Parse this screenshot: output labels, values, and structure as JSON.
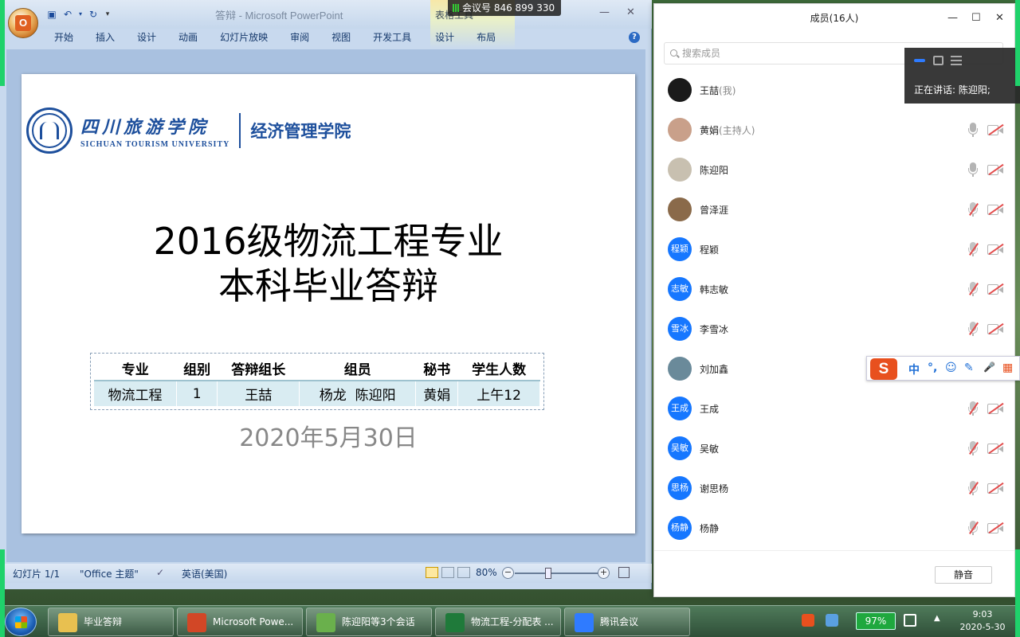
{
  "powerpoint": {
    "title": "答辩 - Microsoft PowerPoint",
    "office_button": "O",
    "table_tools_label": "表格工具",
    "tabs": [
      "开始",
      "插入",
      "设计",
      "动画",
      "幻灯片放映",
      "审阅",
      "视图",
      "开发工具",
      "设计",
      "布局"
    ],
    "help": "?",
    "slide": {
      "university_cn": "四川旅游学院",
      "university_en": "SICHUAN TOURISM UNIVERSITY",
      "college": "经济管理学院",
      "title_line1": "2016级物流工程专业",
      "title_line2": "本科毕业答辩",
      "table": {
        "headers": [
          "专业",
          "组别",
          "答辩组长",
          "组员",
          "秘书",
          "学生人数"
        ],
        "row": [
          "物流工程",
          "1",
          "王喆",
          "杨龙  陈迎阳",
          "黄娟",
          "上午12"
        ]
      },
      "date": "2020年5月30日"
    },
    "status": {
      "slide_count": "幻灯片 1/1",
      "theme": "\"Office 主题\"",
      "language": "英语(美国)",
      "zoom": "80%",
      "zoom_level": 0.8
    }
  },
  "meeting_bar": {
    "meeting_number": "会议号 846 899 330"
  },
  "members_panel": {
    "title": "成员(16人)",
    "search_placeholder": "搜索成员",
    "speaking": "正在讲话: 陈迎阳;",
    "mute_all": "静音",
    "members": [
      {
        "name": "王喆",
        "tag": "(我)",
        "avatar": "",
        "avatar_color": "#1a1a1a",
        "mic": "none",
        "cam": "none"
      },
      {
        "name": "黄娟",
        "tag": "(主持人)",
        "avatar": "",
        "avatar_color": "#c9a08a",
        "mic": "on",
        "cam": "off"
      },
      {
        "name": "陈迎阳",
        "tag": "",
        "avatar": "",
        "avatar_color": "#c8c0b0",
        "mic": "on",
        "cam": "off"
      },
      {
        "name": "曾泽涯",
        "tag": "",
        "avatar": "",
        "avatar_color": "#8a6a4a",
        "mic": "muted",
        "cam": "off"
      },
      {
        "name": "程颖",
        "tag": "",
        "avatar": "程颖",
        "avatar_color": "#1677ff",
        "mic": "muted",
        "cam": "off"
      },
      {
        "name": "韩志敏",
        "tag": "",
        "avatar": "志敏",
        "avatar_color": "#1677ff",
        "mic": "muted",
        "cam": "off"
      },
      {
        "name": "李雪冰",
        "tag": "",
        "avatar": "雪冰",
        "avatar_color": "#1677ff",
        "mic": "muted",
        "cam": "off"
      },
      {
        "name": "刘加鑫",
        "tag": "",
        "avatar": "",
        "avatar_color": "#6a8a9a",
        "mic": "none",
        "cam": "none"
      },
      {
        "name": "王成",
        "tag": "",
        "avatar": "王成",
        "avatar_color": "#1677ff",
        "mic": "muted",
        "cam": "off"
      },
      {
        "name": "吴敏",
        "tag": "",
        "avatar": "吴敏",
        "avatar_color": "#1677ff",
        "mic": "muted",
        "cam": "off"
      },
      {
        "name": "谢思杨",
        "tag": "",
        "avatar": "思杨",
        "avatar_color": "#1677ff",
        "mic": "muted",
        "cam": "off"
      },
      {
        "name": "杨静",
        "tag": "",
        "avatar": "杨静",
        "avatar_color": "#1677ff",
        "mic": "muted",
        "cam": "off"
      }
    ]
  },
  "ime_toolbar": {
    "logo": "S",
    "items": [
      "中",
      "°,",
      "☺",
      "✎",
      "🎤",
      "▦"
    ]
  },
  "taskbar": {
    "items": [
      {
        "label": "毕业答辩",
        "icon_color": "#e8c050"
      },
      {
        "label": "Microsoft Powe...",
        "icon_color": "#d24726"
      },
      {
        "label": "陈迎阳等3个会话",
        "icon_color": "#6ab04c"
      },
      {
        "label": "物流工程-分配表 ...",
        "icon_color": "#1f7a3a"
      },
      {
        "label": "腾讯会议",
        "icon_color": "#2f7bff"
      }
    ],
    "battery": "97%",
    "time": "9:03",
    "date": "2020-5-30"
  }
}
